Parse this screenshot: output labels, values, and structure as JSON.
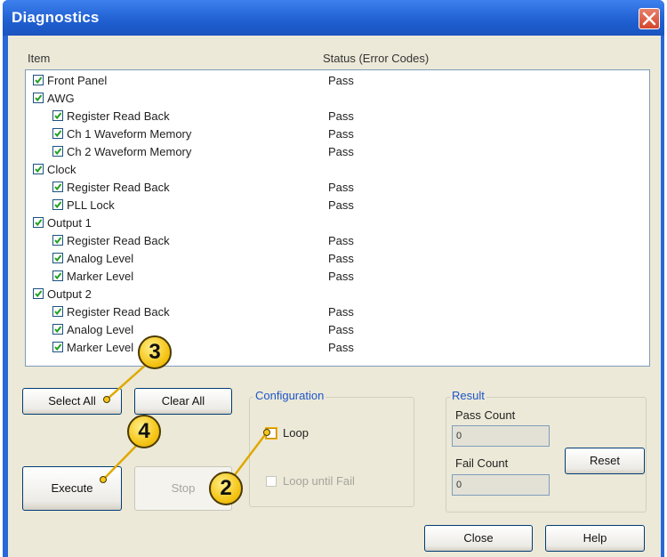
{
  "window": {
    "title": "Diagnostics"
  },
  "list": {
    "col_item": "Item",
    "col_status": "Status (Error Codes)",
    "rows": [
      {
        "label": "Front Panel",
        "status": "Pass"
      },
      {
        "label": "AWG",
        "status": ""
      },
      {
        "label": "Register Read Back",
        "status": "Pass"
      },
      {
        "label": "Ch 1 Waveform Memory",
        "status": "Pass"
      },
      {
        "label": "Ch 2 Waveform Memory",
        "status": "Pass"
      },
      {
        "label": "Clock",
        "status": ""
      },
      {
        "label": "Register Read Back",
        "status": "Pass"
      },
      {
        "label": "PLL Lock",
        "status": "Pass"
      },
      {
        "label": "Output 1",
        "status": ""
      },
      {
        "label": "Register Read Back",
        "status": "Pass"
      },
      {
        "label": "Analog Level",
        "status": "Pass"
      },
      {
        "label": "Marker Level",
        "status": "Pass"
      },
      {
        "label": "Output 2",
        "status": ""
      },
      {
        "label": "Register Read Back",
        "status": "Pass"
      },
      {
        "label": "Analog Level",
        "status": "Pass"
      },
      {
        "label": "Marker Level",
        "status": "Pass"
      }
    ]
  },
  "buttons": {
    "select_all": "Select All",
    "clear_all": "Clear All",
    "execute": "Execute",
    "stop": "Stop",
    "reset": "Reset",
    "close": "Close",
    "help": "Help"
  },
  "configuration": {
    "title": "Configuration",
    "loop": "Loop",
    "loop_until_fail": "Loop until Fail"
  },
  "result": {
    "title": "Result",
    "pass_count_label": "Pass Count",
    "pass_count": "0",
    "fail_count_label": "Fail Count",
    "fail_count": "0"
  },
  "callouts": {
    "c2": "2",
    "c3": "3",
    "c4": "4"
  },
  "colors": {
    "title_bar": "#2867d8",
    "callout": "#f5c518",
    "group_title": "#1e55c8"
  }
}
